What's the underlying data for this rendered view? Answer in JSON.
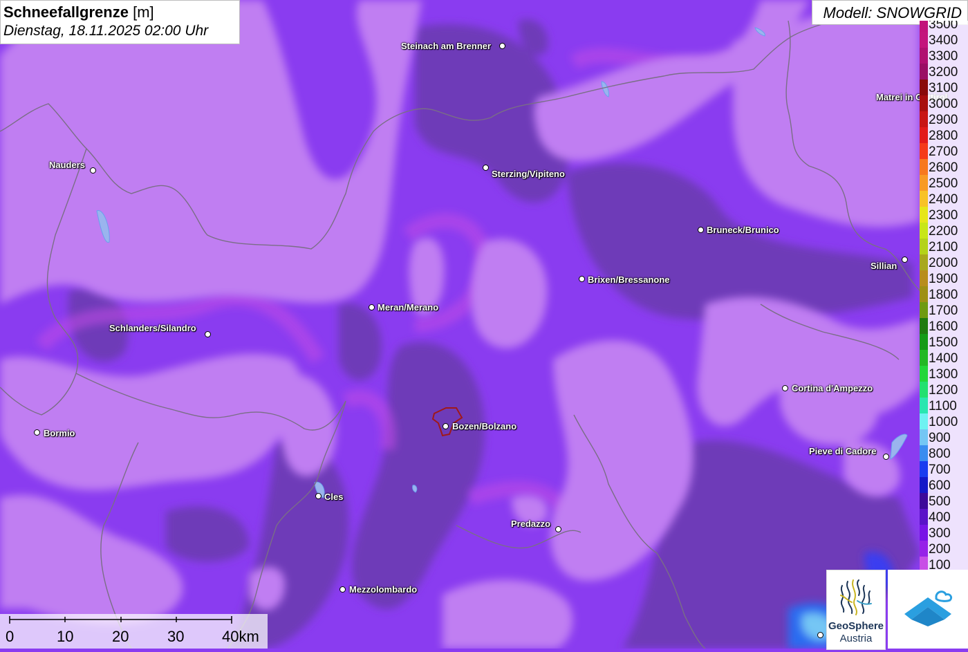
{
  "title": {
    "parameter": "Schneefallgrenze",
    "unit": "[m]",
    "datetime": "Dienstag, 18.11.2025 02:00 Uhr"
  },
  "model": "Modell: SNOWGRID",
  "legend": {
    "unit": "m",
    "items": [
      {
        "label": "3500",
        "color": "#c2127a"
      },
      {
        "label": "3400",
        "color": "#c3147c"
      },
      {
        "label": "3300",
        "color": "#b01070"
      },
      {
        "label": "3200",
        "color": "#9a0e64"
      },
      {
        "label": "3100",
        "color": "#8a0a0a"
      },
      {
        "label": "3000",
        "color": "#a80e0e"
      },
      {
        "label": "2900",
        "color": "#c81414"
      },
      {
        "label": "2800",
        "color": "#e21a1a"
      },
      {
        "label": "2700",
        "color": "#f53a1a"
      },
      {
        "label": "2600",
        "color": "#f7781f"
      },
      {
        "label": "2500",
        "color": "#f89a26"
      },
      {
        "label": "2400",
        "color": "#f8c227"
      },
      {
        "label": "2300",
        "color": "#e6e61a"
      },
      {
        "label": "2200",
        "color": "#c8e619"
      },
      {
        "label": "2100",
        "color": "#b4d21a"
      },
      {
        "label": "2000",
        "color": "#a8a81e"
      },
      {
        "label": "1900",
        "color": "#b88d1d"
      },
      {
        "label": "1800",
        "color": "#9e9016"
      },
      {
        "label": "1700",
        "color": "#6f9a12"
      },
      {
        "label": "1600",
        "color": "#1f7a10"
      },
      {
        "label": "1500",
        "color": "#159a18"
      },
      {
        "label": "1400",
        "color": "#22b825"
      },
      {
        "label": "1300",
        "color": "#22d63a"
      },
      {
        "label": "1200",
        "color": "#22e070"
      },
      {
        "label": "1100",
        "color": "#2ae6b0"
      },
      {
        "label": "1000",
        "color": "#6ff2f2"
      },
      {
        "label": "900",
        "color": "#74c6f4"
      },
      {
        "label": "800",
        "color": "#3a8cf0"
      },
      {
        "label": "700",
        "color": "#1a3cf0"
      },
      {
        "label": "600",
        "color": "#1418c8"
      },
      {
        "label": "500",
        "color": "#3c0a9a"
      },
      {
        "label": "400",
        "color": "#5a12c8"
      },
      {
        "label": "300",
        "color": "#7814e6"
      },
      {
        "label": "200",
        "color": "#9622e8"
      },
      {
        "label": "100",
        "color": "#c84ee6"
      }
    ]
  },
  "scale_bar": {
    "ticks": [
      "0",
      "10",
      "20",
      "30",
      "40km"
    ]
  },
  "places": [
    {
      "name": "Steinach am Brenner"
    },
    {
      "name": "Matrei in Osttirol"
    },
    {
      "name": "Nauders"
    },
    {
      "name": "Sterzing/Vipiteno"
    },
    {
      "name": "Bruneck/Brunico"
    },
    {
      "name": "Sillian"
    },
    {
      "name": "Brixen/Bressanone"
    },
    {
      "name": "Meran/Merano"
    },
    {
      "name": "Schlanders/Silandro"
    },
    {
      "name": "Cortina d'Ampezzo"
    },
    {
      "name": "Bormio"
    },
    {
      "name": "Bozen/Bolzano"
    },
    {
      "name": "Pieve di Cadore"
    },
    {
      "name": "Cles"
    },
    {
      "name": "Predazzo"
    },
    {
      "name": "Mezzolombardo"
    }
  ],
  "logos": {
    "geosphere_name": "GeoSphere",
    "geosphere_country": "Austria"
  },
  "colors": {
    "snowline_high": "#c07ef2",
    "snowline_mid": "#9b40f0",
    "snowline_low": "#6e3bb8",
    "border": "#7a6e86",
    "brand": "#1c3557",
    "app_blue": "#2a9fe0"
  }
}
